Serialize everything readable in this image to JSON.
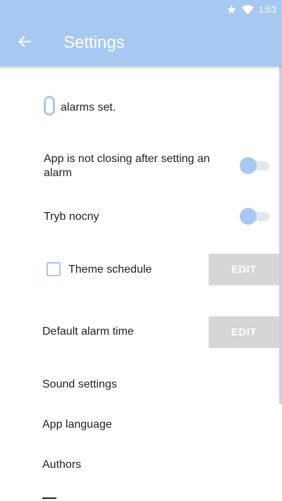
{
  "status_bar": {
    "time": "1:53",
    "icons": [
      "star-icon",
      "wifi-icon"
    ]
  },
  "header": {
    "title": "Settings",
    "back_icon": "arrow-left-icon",
    "background": "#a7c8f0"
  },
  "alarms": {
    "count": "0",
    "label": "alarms set."
  },
  "settings": {
    "keep_open": {
      "label": "App is not closing after setting an alarm",
      "enabled": false
    },
    "night_mode": {
      "label": "Tryb nocny",
      "enabled": false
    },
    "theme_schedule": {
      "label": "Theme schedule",
      "checked": false,
      "button_label": "EDIT"
    },
    "default_alarm_time": {
      "label": "Default alarm time",
      "button_label": "EDIT"
    }
  },
  "menu": {
    "sound_settings": "Sound settings",
    "app_language": "App language",
    "authors": "Authors"
  },
  "colors": {
    "accent": "#a7c8f0",
    "disabled_button": "#d6d6d6",
    "switch_track": "#e6e6e6"
  }
}
